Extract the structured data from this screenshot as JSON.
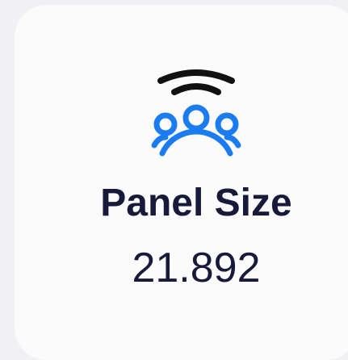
{
  "card": {
    "icon": "group-broadcast-icon",
    "title": "Panel Size",
    "value": "21.892"
  },
  "colors": {
    "accent": "#1a7cf0",
    "dark": "#111111",
    "title": "#171a3b",
    "value": "#171a3b",
    "card_bg": "#fbfbfb",
    "page_bg": "#f1f1f3"
  }
}
